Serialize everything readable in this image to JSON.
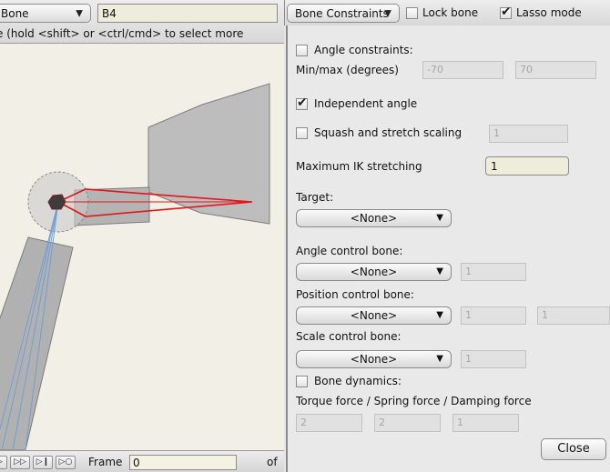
{
  "left_toolbar": {
    "mode_dropdown": "Bone",
    "bone_name": "B4",
    "hint": "e (hold <shift> or <ctrl/cmd> to select more"
  },
  "transport": {
    "buttons": [
      "▷",
      "▷▷",
      "▷❙",
      "▷○"
    ],
    "frame_label": "Frame",
    "frame_value": "0",
    "of_label": "of"
  },
  "right_toolbar": {
    "panel_dropdown": "Bone Constraints",
    "lock_bone": "Lock bone",
    "lock_bone_checked": false,
    "lasso_mode": "Lasso mode",
    "lasso_mode_checked": true
  },
  "constraints": {
    "angle_constraints": {
      "label": "Angle constraints:",
      "checked": false
    },
    "minmax_label": "Min/max (degrees)",
    "min_value": "-70",
    "max_value": "70",
    "independent_angle": {
      "label": "Independent angle",
      "checked": true
    },
    "squash": {
      "label": "Squash and stretch scaling",
      "checked": false,
      "value": "1"
    },
    "max_ik_label": "Maximum IK stretching",
    "max_ik_value": "1",
    "target_label": "Target:",
    "target_value": "<None>",
    "angle_control_label": "Angle control bone:",
    "angle_control_value": "<None>",
    "angle_control_field": "1",
    "position_control_label": "Position control bone:",
    "position_control_value": "<None>",
    "position_field_1": "1",
    "position_field_2": "1",
    "scale_control_label": "Scale control bone:",
    "scale_control_value": "<None>",
    "scale_field": "1",
    "bone_dynamics": {
      "label": "Bone dynamics:",
      "checked": false
    },
    "forces_label": "Torque force / Spring force / Damping force",
    "torque": "2",
    "spring": "2",
    "damping": "1",
    "close": "Close"
  },
  "colors": {
    "viewport_bg": "#f2f0e6",
    "selected_bone": "#e01818",
    "bone_fill": "#b9b9b9",
    "field_bg": "#eeecda"
  }
}
